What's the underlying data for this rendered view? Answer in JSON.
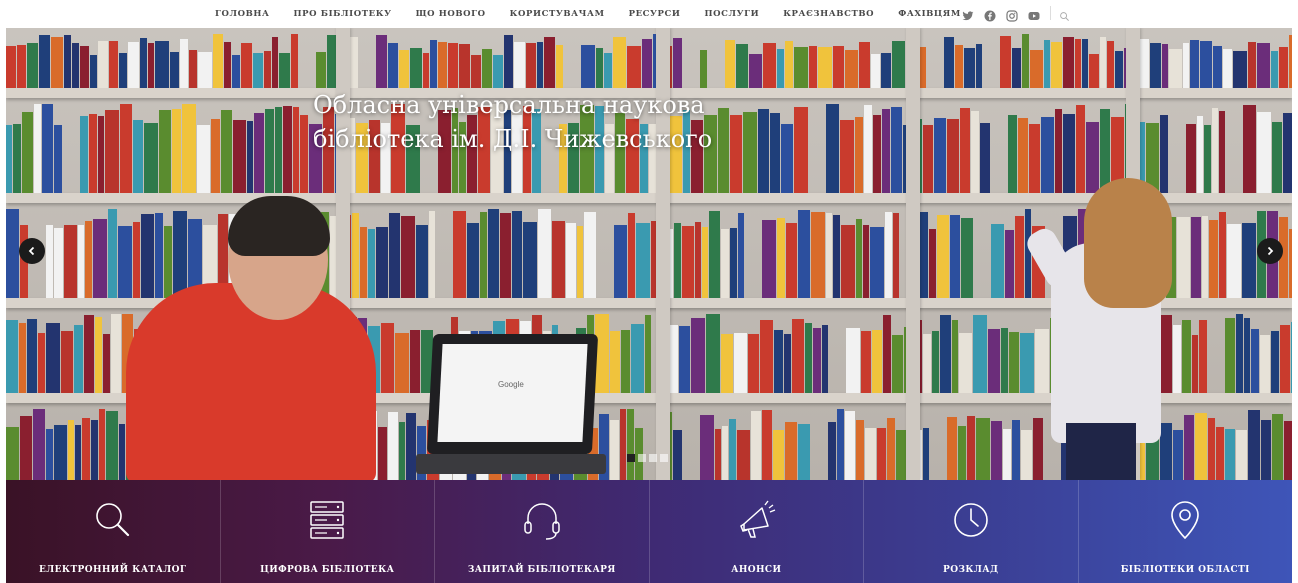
{
  "nav": {
    "items": [
      {
        "label": "ГОЛОВНА"
      },
      {
        "label": "ПРО БІБЛІОТЕКУ"
      },
      {
        "label": "ЩО НОВОГО"
      },
      {
        "label": "КОРИСТУВАЧАМ"
      },
      {
        "label": "РЕСУРСИ"
      },
      {
        "label": "ПОСЛУГИ"
      },
      {
        "label": "КРАЄЗНАВСТВО"
      },
      {
        "label": "ФАХІВЦЯМ"
      }
    ],
    "social_icons": [
      "twitter-icon",
      "facebook-icon",
      "instagram-icon",
      "youtube-icon"
    ],
    "search_icon": "search-icon"
  },
  "hero": {
    "title_line1": "Обласна універсальна наукова",
    "title_line2": "бібліотека ім. Д.І. Чижевського",
    "laptop_text": "Google",
    "slides_total": 4,
    "active_slide": 1
  },
  "quick_links": [
    {
      "label": "ЕЛЕКТРОННИЙ КАТАЛОГ",
      "icon": "search-icon"
    },
    {
      "label": "ЦИФРОВА БІБЛІОТЕКА",
      "icon": "server-icon"
    },
    {
      "label": "ЗАПИТАЙ БІБЛІОТЕКАРЯ",
      "icon": "headset-icon"
    },
    {
      "label": "АНОНСИ",
      "icon": "megaphone-icon"
    },
    {
      "label": "РОЗКЛАД",
      "icon": "clock-icon"
    },
    {
      "label": "БІБЛІОТЕКИ ОБЛАСТІ",
      "icon": "location-pin-icon"
    }
  ],
  "colors": {
    "quick_bar_start": "#3a1226",
    "quick_bar_end": "#3e55b8",
    "nav_text": "#4a4a4a"
  }
}
